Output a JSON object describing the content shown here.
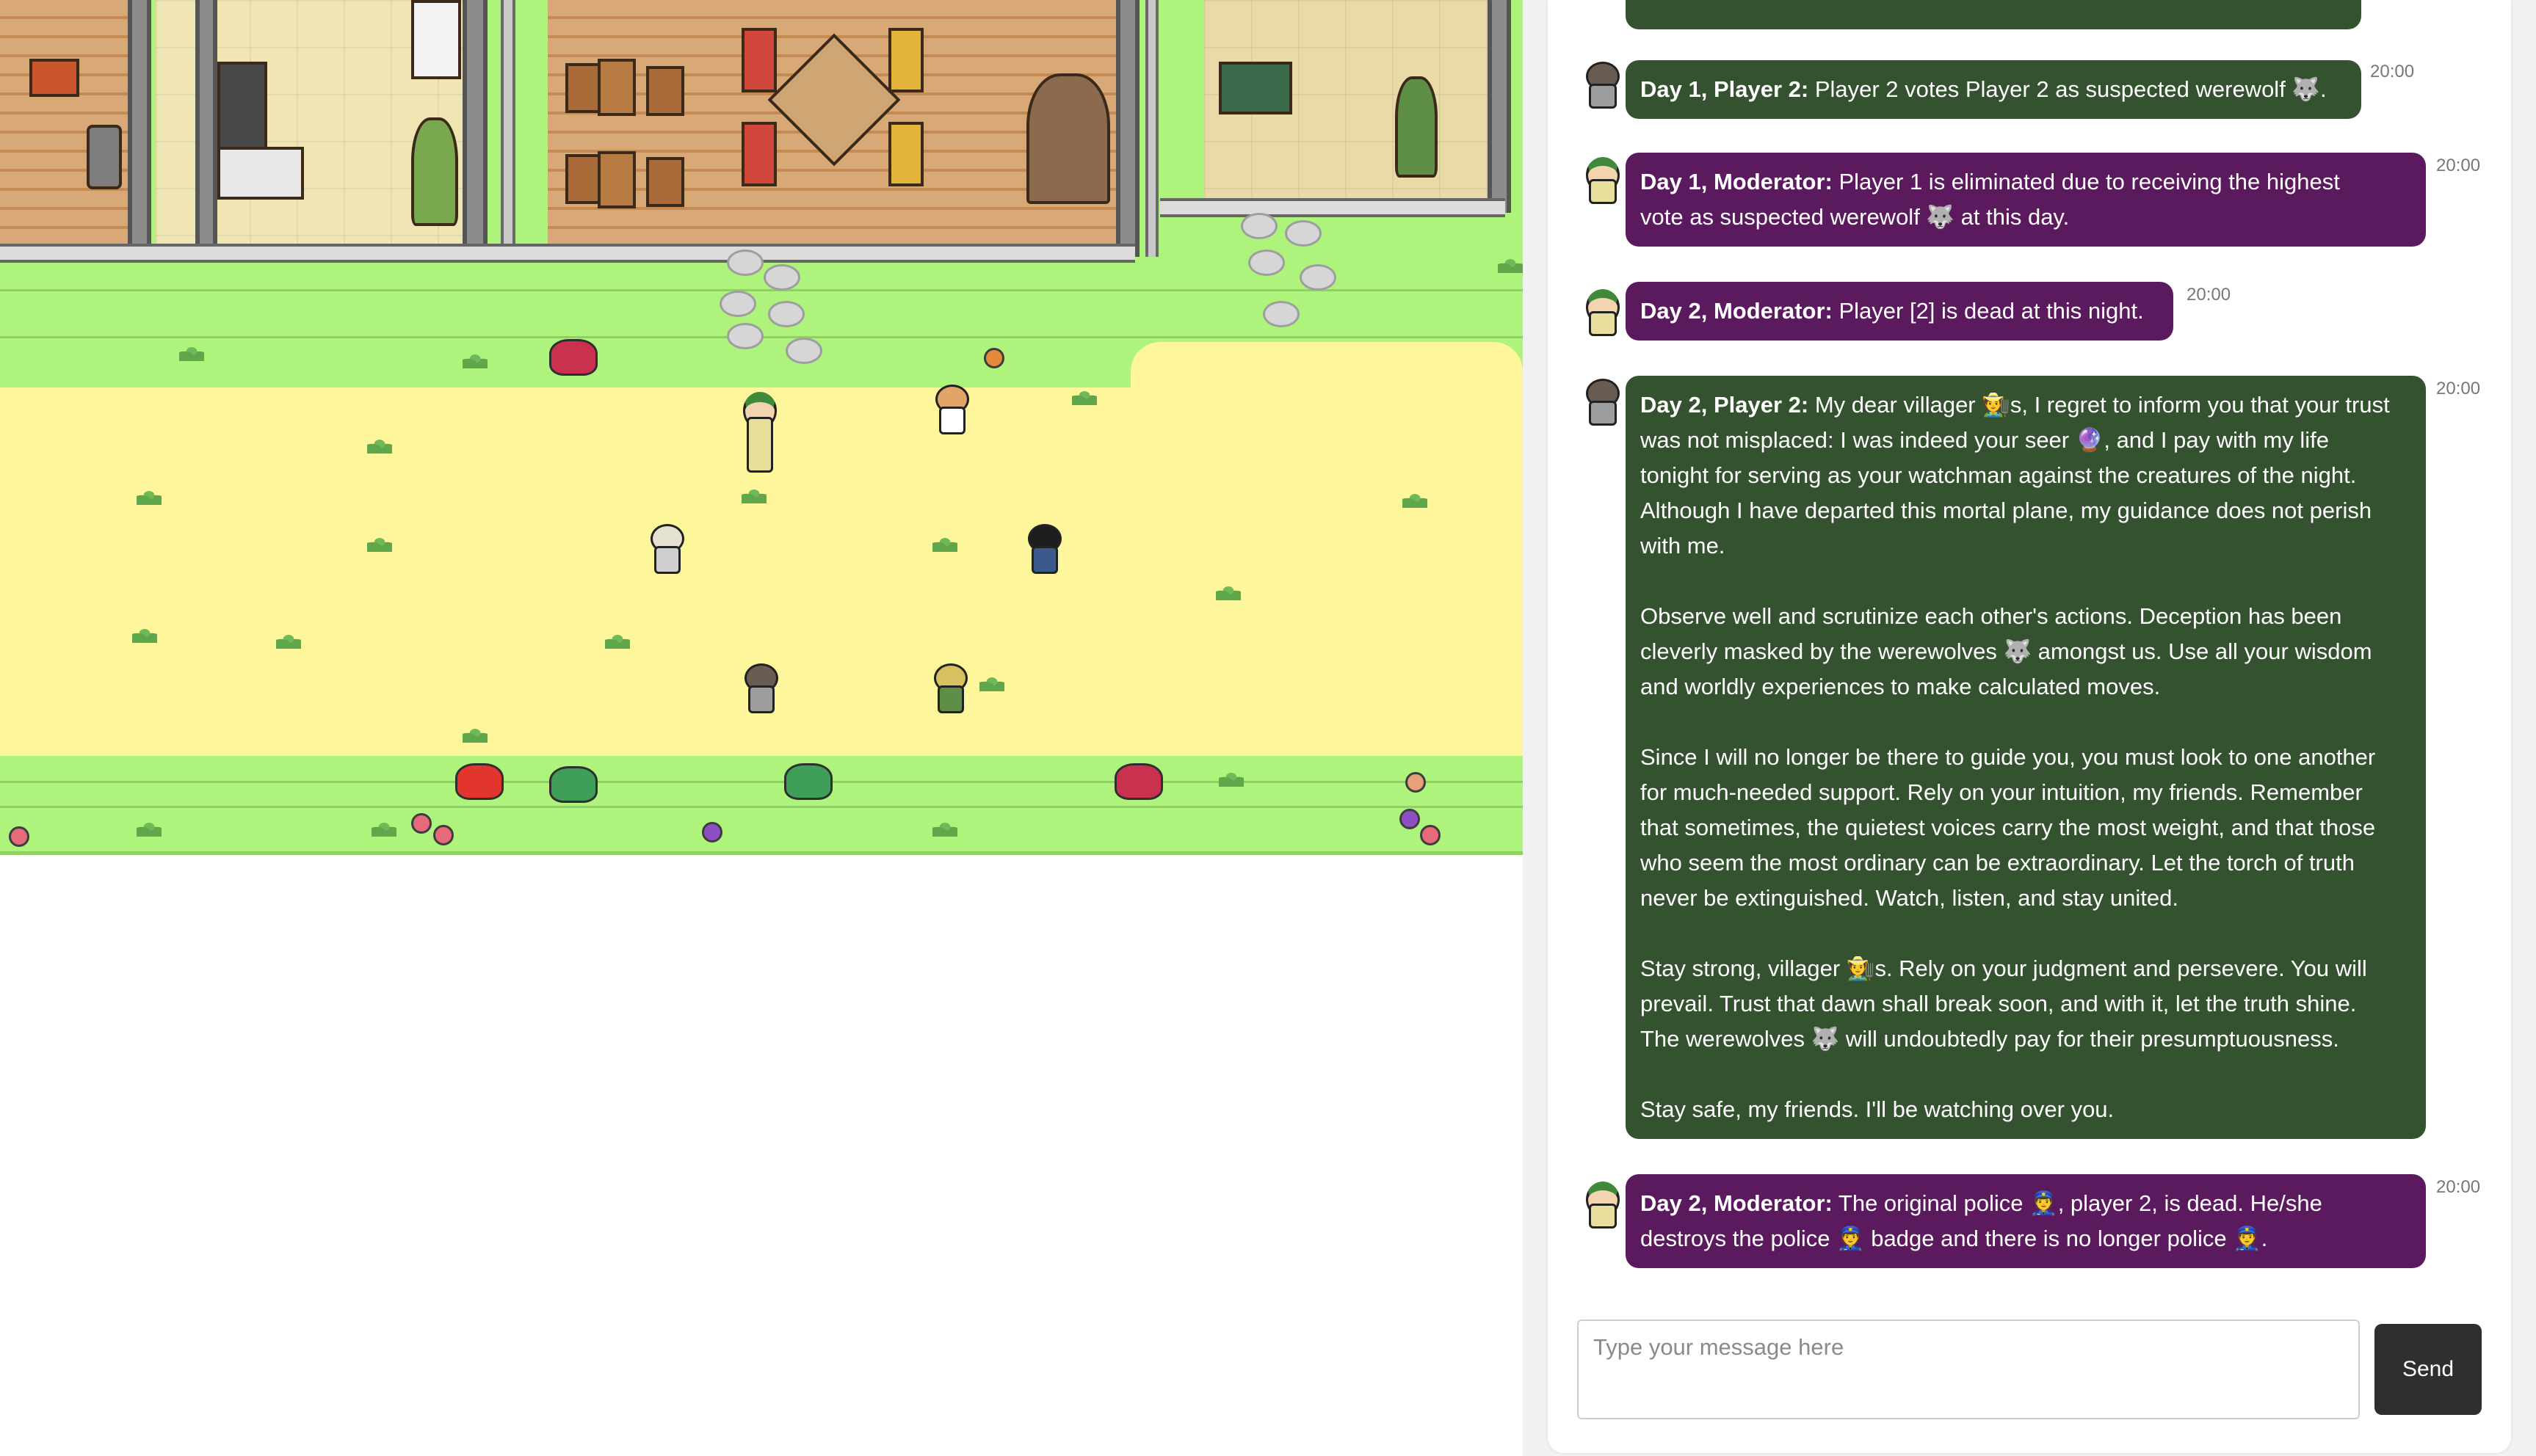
{
  "game": {
    "description_icons": [
      "villager-sprite",
      "moderator-sprite",
      "cat-sprite"
    ]
  },
  "chat": {
    "messages": [
      {
        "speaker": "Day 1, Player 2:",
        "text": "Player 2 votes Player 2 as suspected werewolf 🐺.",
        "time": "20:00",
        "role": "player"
      },
      {
        "speaker": "Day 1, Moderator:",
        "text_line1": "Player 1 is eliminated due to receiving the highest",
        "text_line2": "vote as suspected werewolf 🐺 at this day.",
        "time": "20:00",
        "role": "moderator"
      },
      {
        "speaker": "Day 2, Moderator:",
        "text": "Player [2] is dead at this night.",
        "time": "20:00",
        "role": "moderator"
      },
      {
        "speaker": "Day 2, Player 2:",
        "p1_lead": "My dear villager 🧑‍🌾s, I regret to inform you that your trust",
        "p1_l2": "was not misplaced: I was indeed your seer 🔮, and I pay with my life",
        "p1_l3": "tonight for serving as your watchman against the creatures of the night.",
        "p1_l4": "Although I have departed this mortal plane, my guidance does not perish",
        "p1_l5": "with me.",
        "p2_l1": "Observe well and scrutinize each other's actions. Deception has been",
        "p2_l2": "cleverly masked by the werewolves 🐺 amongst us. Use all your wisdom",
        "p2_l3": "and worldly experiences to make calculated moves.",
        "p3_l1": "Since I will no longer be there to guide you, you must look to one another",
        "p3_l2": "for much-needed support. Rely on your intuition, my friends. Remember",
        "p3_l3": "that sometimes, the quietest voices carry the most weight, and that those",
        "p3_l4": "who seem the most ordinary can be extraordinary. Let the torch of truth",
        "p3_l5": "never be extinguished. Watch, listen, and stay united.",
        "p4_l1": "Stay strong, villager 🧑‍🌾s. Rely on your judgment and persevere. You will",
        "p4_l2": "prevail. Trust that dawn shall break soon, and with it, let the truth shine.",
        "p4_l3": "The werewolves 🐺 will undoubtedly pay for their presumptuousness.",
        "p5_l1": "Stay safe, my friends. I'll be watching over you.",
        "time": "20:00",
        "role": "player"
      },
      {
        "speaker": "Day 2, Moderator:",
        "text_line1": "The original police 👮, player 2, is dead. He/she",
        "text_line2": "destroys the police 👮 badge and there is no longer police 👮.",
        "time": "20:00",
        "role": "moderator"
      }
    ],
    "input_placeholder": "Type your message here",
    "send_label": "Send"
  },
  "colors": {
    "player_bubble": "#34522f",
    "moderator_bubble": "#5c1a5e",
    "grass": "#aef47c",
    "sand": "#fdf69a"
  }
}
